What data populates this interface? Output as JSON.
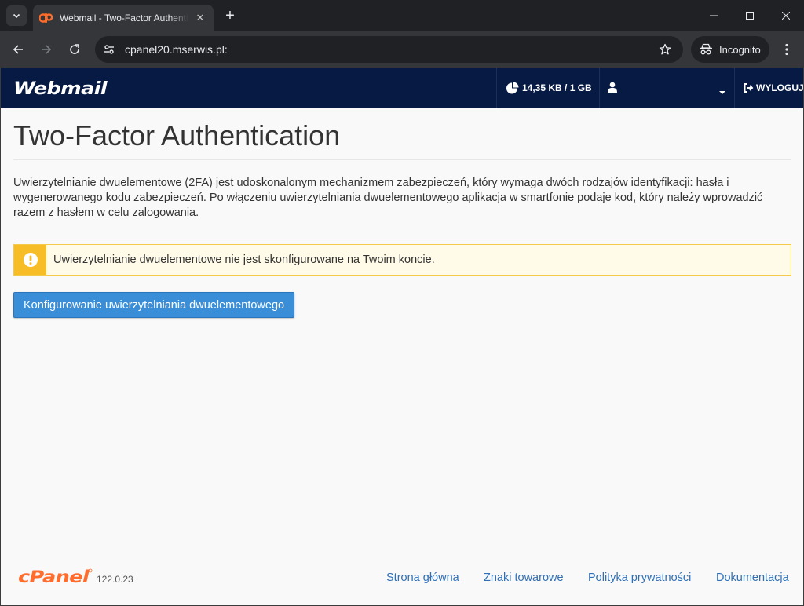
{
  "browser": {
    "tab_title": "Webmail - Two-Factor Authentication",
    "url": "cpanel20.mserwis.pl:",
    "incognito_label": "Incognito"
  },
  "header": {
    "logo_text": "Webmail",
    "quota": "14,35 KB / 1 GB",
    "logout": "WYLOGUJ"
  },
  "main": {
    "title": "Two-Factor Authentication",
    "intro": "Uwierzytelnianie dwuelementowe (2FA) jest udoskonalonym mechanizmem zabezpieczeń, który wymaga dwóch rodzajów identyfikacji: hasła i wygenerowanego kodu zabezpieczeń. Po włączeniu uwierzytelniania dwuelementowego aplikacja w smartfonie podaje kod, który należy wprowadzić razem z hasłem w celu zalogowania.",
    "alert": "Uwierzytelnianie dwuelementowe nie jest skonfigurowane na Twoim koncie.",
    "configure_button": "Konfigurowanie uwierzytelniania dwuelementowego"
  },
  "footer": {
    "brand": "cPanel",
    "version": "122.0.23",
    "links": [
      "Strona główna",
      "Znaki towarowe",
      "Polityka prywatności",
      "Dokumentacja"
    ]
  },
  "colors": {
    "header_bg": "#071a43",
    "alert_accent": "#f7bd26",
    "button_bg": "#3a8ed8",
    "cpanel_orange": "#ff6c2c",
    "link": "#2f6fb7"
  },
  "icons": {
    "tab_search": "chevron-down-icon",
    "favicon": "cpanel-icon",
    "back": "arrow-left-icon",
    "forward": "arrow-right-icon",
    "reload": "reload-icon",
    "site_info": "tune-icon",
    "bookmark": "star-icon",
    "incognito": "incognito-icon",
    "menu": "kebab-icon",
    "quota": "pie-chart-icon",
    "user": "user-icon",
    "logout": "sign-out-icon",
    "alert": "exclamation-icon"
  }
}
